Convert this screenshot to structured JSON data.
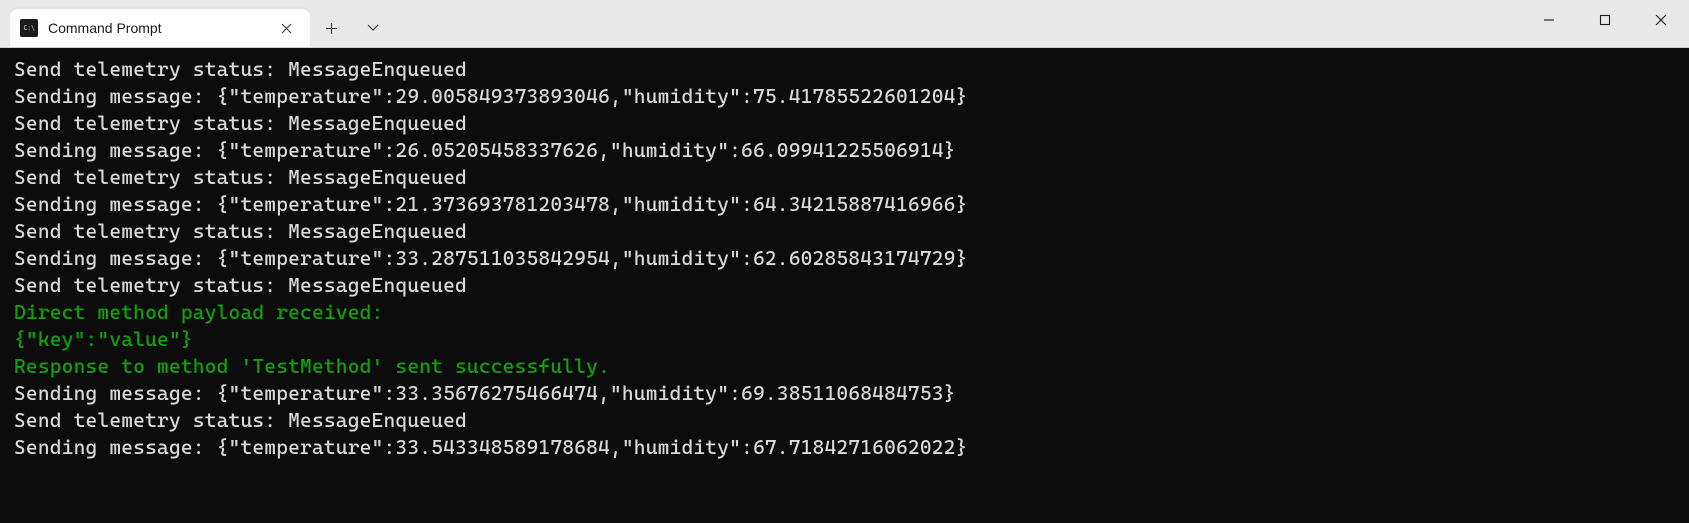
{
  "titlebar": {
    "tab": {
      "icon_glyph": "C:\\",
      "title": "Command Prompt"
    }
  },
  "terminal": {
    "lines": [
      {
        "cls": "",
        "text": "Send telemetry status: MessageEnqueued"
      },
      {
        "cls": "",
        "text": "Sending message: {\"temperature\":29.005849373893046,\"humidity\":75.41785522601204}"
      },
      {
        "cls": "",
        "text": "Send telemetry status: MessageEnqueued"
      },
      {
        "cls": "",
        "text": "Sending message: {\"temperature\":26.05205458337626,\"humidity\":66.09941225506914}"
      },
      {
        "cls": "",
        "text": "Send telemetry status: MessageEnqueued"
      },
      {
        "cls": "",
        "text": "Sending message: {\"temperature\":21.373693781203478,\"humidity\":64.34215887416966}"
      },
      {
        "cls": "",
        "text": "Send telemetry status: MessageEnqueued"
      },
      {
        "cls": "",
        "text": "Sending message: {\"temperature\":33.287511035842954,\"humidity\":62.60285843174729}"
      },
      {
        "cls": "",
        "text": "Send telemetry status: MessageEnqueued"
      },
      {
        "cls": "green",
        "text": "Direct method payload received:"
      },
      {
        "cls": "green",
        "text": "{\"key\":\"value\"}"
      },
      {
        "cls": "green",
        "text": "Response to method 'TestMethod' sent successfully."
      },
      {
        "cls": "",
        "text": "Sending message: {\"temperature\":33.35676275466474,\"humidity\":69.38511068484753}"
      },
      {
        "cls": "",
        "text": "Send telemetry status: MessageEnqueued"
      },
      {
        "cls": "",
        "text": "Sending message: {\"temperature\":33.543348589178684,\"humidity\":67.71842716062022}"
      }
    ]
  }
}
